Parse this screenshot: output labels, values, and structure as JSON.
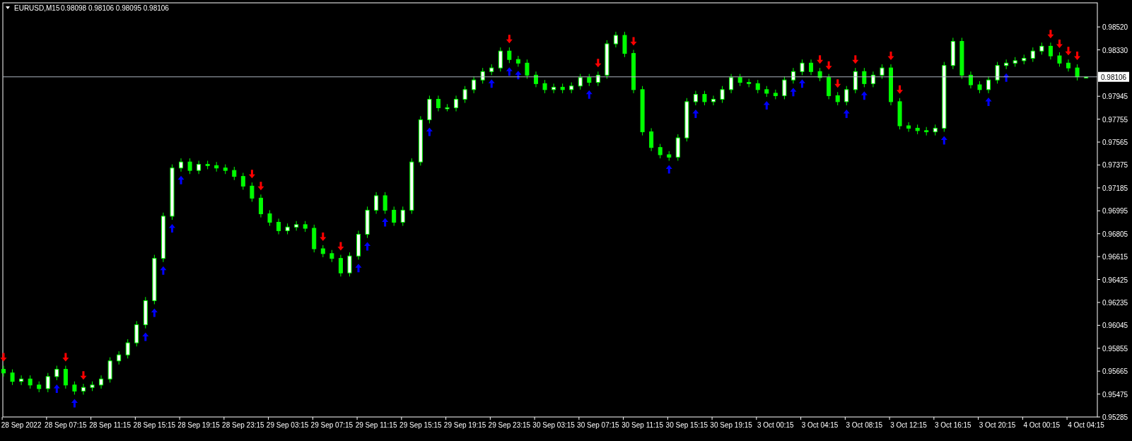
{
  "header": {
    "symbol": "EURUSD,M15",
    "quote": "0.98098 0.98106 0.98095 0.98106"
  },
  "chart": {
    "chart_data": {
      "type": "candlestick",
      "ylim": [
        0.95285,
        0.9872
      ],
      "yticks": [
        {
          "value": 0.9852,
          "label": "0.98520"
        },
        {
          "value": 0.9833,
          "label": "0.98330"
        },
        {
          "value": 0.97945,
          "label": "0.97945"
        },
        {
          "value": 0.97755,
          "label": "0.97755"
        },
        {
          "value": 0.97565,
          "label": "0.97565"
        },
        {
          "value": 0.97375,
          "label": "0.97375"
        },
        {
          "value": 0.97185,
          "label": "0.97185"
        },
        {
          "value": 0.96995,
          "label": "0.96995"
        },
        {
          "value": 0.96805,
          "label": "0.96805"
        },
        {
          "value": 0.96615,
          "label": "0.96615"
        },
        {
          "value": 0.96425,
          "label": "0.96425"
        },
        {
          "value": 0.96235,
          "label": "0.96235"
        },
        {
          "value": 0.96045,
          "label": "0.96045"
        },
        {
          "value": 0.95855,
          "label": "0.95855"
        },
        {
          "value": 0.95665,
          "label": "0.95665"
        },
        {
          "value": 0.95475,
          "label": "0.95475"
        },
        {
          "value": 0.95285,
          "label": "0.95285"
        }
      ],
      "categories": [
        null,
        null,
        "28 Sep 2022",
        null,
        null,
        null,
        null,
        "28 Sep 07:15",
        null,
        null,
        null,
        null,
        "28 Sep 11:15",
        null,
        null,
        null,
        null,
        "28 Sep 15:15",
        null,
        null,
        null,
        null,
        "28 Sep 19:15",
        null,
        null,
        null,
        null,
        "28 Sep 23:15",
        null,
        null,
        null,
        null,
        "29 Sep 03:15",
        null,
        null,
        null,
        null,
        "29 Sep 07:15",
        null,
        null,
        null,
        null,
        "29 Sep 11:15",
        null,
        null,
        null,
        null,
        "29 Sep 15:15",
        null,
        null,
        null,
        null,
        "29 Sep 19:15",
        null,
        null,
        null,
        null,
        "29 Sep 23:15",
        null,
        null,
        null,
        null,
        "30 Sep 03:15",
        null,
        null,
        null,
        null,
        "30 Sep 07:15",
        null,
        null,
        null,
        null,
        "30 Sep 11:15",
        null,
        null,
        null,
        null,
        "30 Sep 15:15",
        null,
        null,
        null,
        null,
        "30 Sep 19:15",
        null,
        null,
        null,
        null,
        "3 Oct 00:15",
        null,
        null,
        null,
        null,
        "3 Oct 04:15",
        null,
        null,
        null,
        null,
        "3 Oct 08:15",
        null,
        null,
        null,
        null,
        "3 Oct 12:15",
        null,
        null,
        null,
        null,
        "3 Oct 16:15",
        null,
        null,
        null,
        null,
        "3 Oct 20:15",
        null,
        null,
        null,
        null,
        "4 Oct 00:15",
        null,
        null,
        null,
        null,
        "4 Oct 04:15"
      ],
      "ohlc": [
        [
          0.9568,
          0.9571,
          0.9562,
          0.9565
        ],
        [
          0.9565,
          0.9568,
          0.9555,
          0.9558
        ],
        [
          0.9558,
          0.9563,
          0.9555,
          0.956
        ],
        [
          0.956,
          0.9563,
          0.9552,
          0.9555
        ],
        [
          0.9555,
          0.9558,
          0.9549,
          0.9552
        ],
        [
          0.9552,
          0.9565,
          0.9549,
          0.9562
        ],
        [
          0.9562,
          0.9571,
          0.9559,
          0.9568
        ],
        [
          0.9568,
          0.9571,
          0.9552,
          0.9555
        ],
        [
          0.9555,
          0.9558,
          0.9547,
          0.955
        ],
        [
          0.955,
          0.9556,
          0.9547,
          0.9553
        ],
        [
          0.9553,
          0.9558,
          0.955,
          0.9555
        ],
        [
          0.9555,
          0.9563,
          0.9552,
          0.956
        ],
        [
          0.956,
          0.9578,
          0.9557,
          0.9575
        ],
        [
          0.9575,
          0.9583,
          0.9572,
          0.958
        ],
        [
          0.958,
          0.9593,
          0.9577,
          0.959
        ],
        [
          0.959,
          0.9608,
          0.9587,
          0.9605
        ],
        [
          0.9605,
          0.9628,
          0.9602,
          0.9625
        ],
        [
          0.9625,
          0.9663,
          0.9622,
          0.966
        ],
        [
          0.966,
          0.9698,
          0.9657,
          0.9695
        ],
        [
          0.9695,
          0.9738,
          0.9692,
          0.9735
        ],
        [
          0.9735,
          0.9743,
          0.9732,
          0.974
        ],
        [
          0.974,
          0.9743,
          0.973,
          0.9733
        ],
        [
          0.9733,
          0.9741,
          0.973,
          0.9738
        ],
        [
          0.9738,
          0.9741,
          0.9734,
          0.9737
        ],
        [
          0.9737,
          0.974,
          0.9732,
          0.9735
        ],
        [
          0.9735,
          0.9738,
          0.973,
          0.9733
        ],
        [
          0.9733,
          0.9736,
          0.9725,
          0.9728
        ],
        [
          0.9728,
          0.9731,
          0.9717,
          0.972
        ],
        [
          0.972,
          0.9723,
          0.9707,
          0.971
        ],
        [
          0.971,
          0.9713,
          0.9694,
          0.9697
        ],
        [
          0.9697,
          0.97,
          0.9687,
          0.969
        ],
        [
          0.969,
          0.9693,
          0.968,
          0.9683
        ],
        [
          0.9683,
          0.9689,
          0.968,
          0.9686
        ],
        [
          0.9686,
          0.9691,
          0.9683,
          0.9688
        ],
        [
          0.9688,
          0.9691,
          0.9682,
          0.9685
        ],
        [
          0.9685,
          0.9688,
          0.9665,
          0.9668
        ],
        [
          0.9668,
          0.9671,
          0.9661,
          0.9664
        ],
        [
          0.9664,
          0.9667,
          0.9657,
          0.966
        ],
        [
          0.966,
          0.9663,
          0.9645,
          0.9648
        ],
        [
          0.9648,
          0.9665,
          0.9645,
          0.9662
        ],
        [
          0.9662,
          0.9683,
          0.9659,
          0.968
        ],
        [
          0.968,
          0.9703,
          0.9677,
          0.97
        ],
        [
          0.97,
          0.9715,
          0.9697,
          0.9712
        ],
        [
          0.9712,
          0.9715,
          0.9697,
          0.97
        ],
        [
          0.97,
          0.9703,
          0.9687,
          0.969
        ],
        [
          0.969,
          0.9703,
          0.9687,
          0.97
        ],
        [
          0.97,
          0.9743,
          0.9697,
          0.974
        ],
        [
          0.974,
          0.9778,
          0.9737,
          0.9775
        ],
        [
          0.9775,
          0.9795,
          0.9772,
          0.9792
        ],
        [
          0.9792,
          0.9795,
          0.9782,
          0.9785
        ],
        [
          0.9785,
          0.9788,
          0.9782,
          0.9785
        ],
        [
          0.9785,
          0.9795,
          0.9782,
          0.9792
        ],
        [
          0.9792,
          0.9803,
          0.9789,
          0.98
        ],
        [
          0.98,
          0.9811,
          0.9797,
          0.9808
        ],
        [
          0.9808,
          0.9818,
          0.9805,
          0.9815
        ],
        [
          0.9815,
          0.9821,
          0.9812,
          0.9818
        ],
        [
          0.9818,
          0.9835,
          0.9815,
          0.9832
        ],
        [
          0.9832,
          0.9835,
          0.9822,
          0.9825
        ],
        [
          0.9825,
          0.9828,
          0.9819,
          0.9822
        ],
        [
          0.9822,
          0.9825,
          0.9809,
          0.9812
        ],
        [
          0.9812,
          0.9815,
          0.9802,
          0.9805
        ],
        [
          0.9805,
          0.9808,
          0.9797,
          0.98
        ],
        [
          0.98,
          0.9805,
          0.9797,
          0.9802
        ],
        [
          0.9802,
          0.9805,
          0.9797,
          0.98
        ],
        [
          0.98,
          0.9806,
          0.9797,
          0.9803
        ],
        [
          0.9803,
          0.9813,
          0.98,
          0.981
        ],
        [
          0.981,
          0.9813,
          0.9803,
          0.9806
        ],
        [
          0.9806,
          0.9815,
          0.9803,
          0.9812
        ],
        [
          0.9812,
          0.9841,
          0.9809,
          0.9838
        ],
        [
          0.9838,
          0.9848,
          0.9835,
          0.9845
        ],
        [
          0.9845,
          0.9848,
          0.9827,
          0.983
        ],
        [
          0.983,
          0.9833,
          0.9797,
          0.98
        ],
        [
          0.98,
          0.9803,
          0.9762,
          0.9765
        ],
        [
          0.9765,
          0.9768,
          0.9749,
          0.9752
        ],
        [
          0.9752,
          0.9755,
          0.9743,
          0.9746
        ],
        [
          0.9746,
          0.9749,
          0.9741,
          0.9744
        ],
        [
          0.9744,
          0.9763,
          0.9741,
          0.976
        ],
        [
          0.976,
          0.9793,
          0.9757,
          0.979
        ],
        [
          0.979,
          0.9799,
          0.9787,
          0.9796
        ],
        [
          0.9796,
          0.9799,
          0.9787,
          0.979
        ],
        [
          0.979,
          0.9795,
          0.9787,
          0.9792
        ],
        [
          0.9792,
          0.9803,
          0.9789,
          0.98
        ],
        [
          0.98,
          0.9813,
          0.9797,
          0.981
        ],
        [
          0.981,
          0.9813,
          0.9803,
          0.9806
        ],
        [
          0.9806,
          0.9809,
          0.9802,
          0.9805
        ],
        [
          0.9805,
          0.9808,
          0.9797,
          0.98
        ],
        [
          0.98,
          0.9803,
          0.9794,
          0.9797
        ],
        [
          0.9797,
          0.98,
          0.9792,
          0.9795
        ],
        [
          0.9795,
          0.9811,
          0.9792,
          0.9808
        ],
        [
          0.9808,
          0.9818,
          0.9805,
          0.9815
        ],
        [
          0.9815,
          0.9825,
          0.9812,
          0.9822
        ],
        [
          0.9822,
          0.9825,
          0.9812,
          0.9815
        ],
        [
          0.9815,
          0.9818,
          0.9807,
          0.981
        ],
        [
          0.981,
          0.9813,
          0.9792,
          0.9795
        ],
        [
          0.9795,
          0.9798,
          0.9787,
          0.979
        ],
        [
          0.979,
          0.9803,
          0.9787,
          0.98
        ],
        [
          0.98,
          0.9818,
          0.9797,
          0.9815
        ],
        [
          0.9815,
          0.9818,
          0.9802,
          0.9805
        ],
        [
          0.9805,
          0.9815,
          0.9802,
          0.9812
        ],
        [
          0.9812,
          0.9821,
          0.9809,
          0.9818
        ],
        [
          0.9818,
          0.9821,
          0.9787,
          0.979
        ],
        [
          0.979,
          0.9793,
          0.9767,
          0.977
        ],
        [
          0.977,
          0.9773,
          0.9765,
          0.9768
        ],
        [
          0.9768,
          0.9771,
          0.9763,
          0.9766
        ],
        [
          0.9766,
          0.9769,
          0.9762,
          0.9765
        ],
        [
          0.9765,
          0.9771,
          0.9762,
          0.9768
        ],
        [
          0.9768,
          0.9823,
          0.9765,
          0.982
        ],
        [
          0.982,
          0.9843,
          0.9817,
          0.984
        ],
        [
          0.984,
          0.9843,
          0.9809,
          0.9812
        ],
        [
          0.9812,
          0.9815,
          0.9801,
          0.9804
        ],
        [
          0.9804,
          0.9807,
          0.9797,
          0.98
        ],
        [
          0.98,
          0.9811,
          0.9797,
          0.9808
        ],
        [
          0.9808,
          0.9823,
          0.9805,
          0.982
        ],
        [
          0.982,
          0.9825,
          0.9817,
          0.9822
        ],
        [
          0.9822,
          0.9827,
          0.9819,
          0.9824
        ],
        [
          0.9824,
          0.9829,
          0.9821,
          0.9826
        ],
        [
          0.9826,
          0.9835,
          0.9823,
          0.9832
        ],
        [
          0.9832,
          0.9839,
          0.9829,
          0.9836
        ],
        [
          0.9836,
          0.9839,
          0.9825,
          0.9828
        ],
        [
          0.9828,
          0.9831,
          0.9819,
          0.9822
        ],
        [
          0.9822,
          0.9825,
          0.9815,
          0.9818
        ],
        [
          0.9818,
          0.9821,
          0.98076,
          0.98106
        ],
        [
          0.98098,
          0.98106,
          0.98095,
          0.98106
        ]
      ],
      "series": [
        {
          "type": "scatter",
          "color": "#ff0000",
          "values": [
            0.9578,
            null,
            null,
            null,
            null,
            null,
            null,
            0.9578,
            null,
            0.9563,
            null,
            null,
            null,
            null,
            null,
            null,
            null,
            null,
            null,
            null,
            null,
            null,
            null,
            null,
            null,
            null,
            null,
            null,
            0.973,
            0.972,
            null,
            null,
            null,
            null,
            null,
            null,
            0.9678,
            null,
            0.967,
            null,
            null,
            null,
            null,
            null,
            null,
            null,
            null,
            null,
            null,
            null,
            null,
            null,
            null,
            null,
            null,
            null,
            null,
            0.9842,
            null,
            null,
            null,
            null,
            null,
            null,
            null,
            null,
            null,
            0.9822,
            null,
            null,
            null,
            0.984,
            null,
            null,
            null,
            null,
            null,
            null,
            null,
            null,
            null,
            null,
            null,
            null,
            null,
            null,
            null,
            null,
            null,
            null,
            null,
            null,
            0.9825,
            0.982,
            0.9805,
            null,
            0.9825,
            null,
            null,
            null,
            0.9828,
            0.98,
            null,
            null,
            null,
            null,
            null,
            null,
            null,
            null,
            null,
            null,
            null,
            null,
            null,
            null,
            null,
            null,
            0.9846,
            0.9838,
            0.9832,
            0.9828,
            null
          ]
        },
        {
          "type": "scatter",
          "color": "#0000ff",
          "values": [
            null,
            null,
            null,
            null,
            null,
            null,
            0.9552,
            null,
            0.954,
            null,
            null,
            null,
            null,
            null,
            null,
            null,
            0.9595,
            0.9615,
            0.965,
            0.9685,
            0.9725,
            null,
            null,
            null,
            null,
            null,
            null,
            null,
            null,
            null,
            null,
            null,
            null,
            null,
            null,
            null,
            null,
            null,
            null,
            null,
            0.9652,
            0.967,
            null,
            0.969,
            null,
            null,
            null,
            null,
            0.9765,
            null,
            null,
            null,
            null,
            null,
            null,
            0.9805,
            null,
            0.9815,
            0.9812,
            null,
            null,
            null,
            null,
            null,
            null,
            null,
            0.9796,
            null,
            null,
            null,
            null,
            null,
            null,
            null,
            null,
            0.9734,
            null,
            null,
            0.978,
            null,
            null,
            null,
            null,
            null,
            null,
            null,
            0.9787,
            null,
            null,
            0.9798,
            0.9805,
            null,
            null,
            null,
            null,
            0.978,
            null,
            0.9795,
            null,
            null,
            null,
            null,
            null,
            null,
            null,
            null,
            0.9758,
            null,
            null,
            null,
            null,
            0.979,
            null,
            0.981,
            null,
            null,
            null,
            null,
            null,
            null,
            null,
            null,
            null
          ]
        }
      ],
      "ref_lines": [
        {
          "axis": "y",
          "value": 0.98106,
          "label": "0.98106"
        }
      ]
    }
  }
}
